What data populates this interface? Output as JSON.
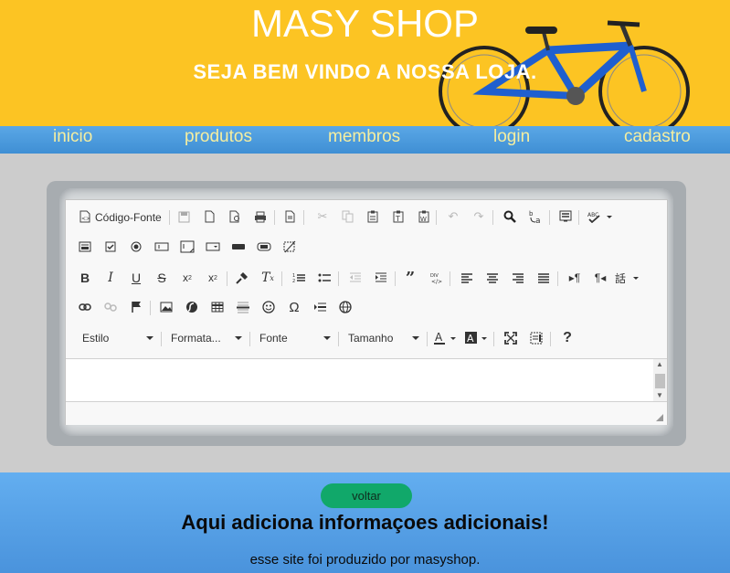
{
  "header": {
    "title": "MASY SHOP",
    "welcome": "SEJA BEM VINDO A NOSSA LOJA."
  },
  "nav": {
    "items": [
      {
        "label": "inicio"
      },
      {
        "label": "produtos"
      },
      {
        "label": "membros"
      },
      {
        "label": "login"
      },
      {
        "label": "cadastro"
      }
    ]
  },
  "editor": {
    "source_label": "Código-Fonte",
    "combos": {
      "style": "Estilo",
      "format": "Formata...",
      "font": "Fonte",
      "size": "Tamanho"
    },
    "help": "?"
  },
  "footer": {
    "back_label": "voltar",
    "heading": "Aqui adiciona informaçoes adicionais!",
    "credit": "esse site foi produzido por masyshop."
  },
  "colors": {
    "header_bg": "#fcc423",
    "nav_bg": "#4f9ee0",
    "nav_text": "#f5eea0",
    "footer_bg": "#5aa3e8",
    "button_bg": "#11a86a"
  }
}
